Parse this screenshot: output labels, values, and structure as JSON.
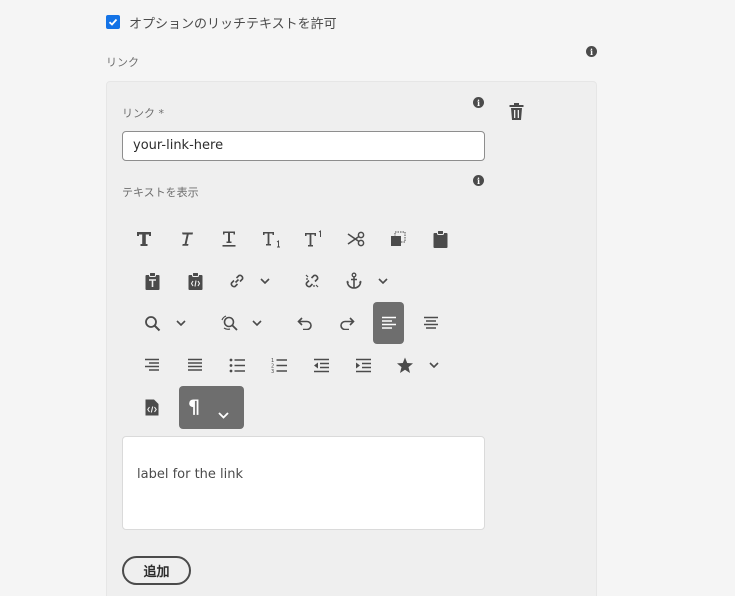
{
  "options": {
    "rich_text_checkbox_checked": true,
    "rich_text_label": "オプションのリッチテキストを許可"
  },
  "links_section": {
    "label": "リンク"
  },
  "link_item": {
    "link_label": "リンク *",
    "link_value": "your-link-here",
    "display_text_label": "テキストを表示",
    "editor_content": "label for the link"
  },
  "icons": {
    "info": "info-icon",
    "delete": "trash-icon",
    "info_glyph": "i"
  },
  "toolbar": {
    "rows": [
      [
        "bold",
        "italic",
        "underline",
        "subscript",
        "superscript",
        "cut",
        "copy",
        "paste"
      ],
      [
        "paste-as-text",
        "paste-from-word",
        "link",
        "unlink",
        "anchor"
      ],
      [
        "find",
        "find-replace",
        "undo",
        "redo",
        "align-left",
        "align-center"
      ],
      [
        "align-right",
        "justify",
        "bullet-list",
        "numbered-list",
        "outdent",
        "indent",
        "special-chars"
      ],
      [
        "source-edit",
        "paragraph-format"
      ]
    ],
    "active": "align-left",
    "paragraph_symbol": "¶"
  },
  "actions": {
    "add_label": "追加"
  },
  "colors": {
    "accent": "#1473e6",
    "icon": "#4b4b4b",
    "active_bg": "#6e6e6e"
  }
}
